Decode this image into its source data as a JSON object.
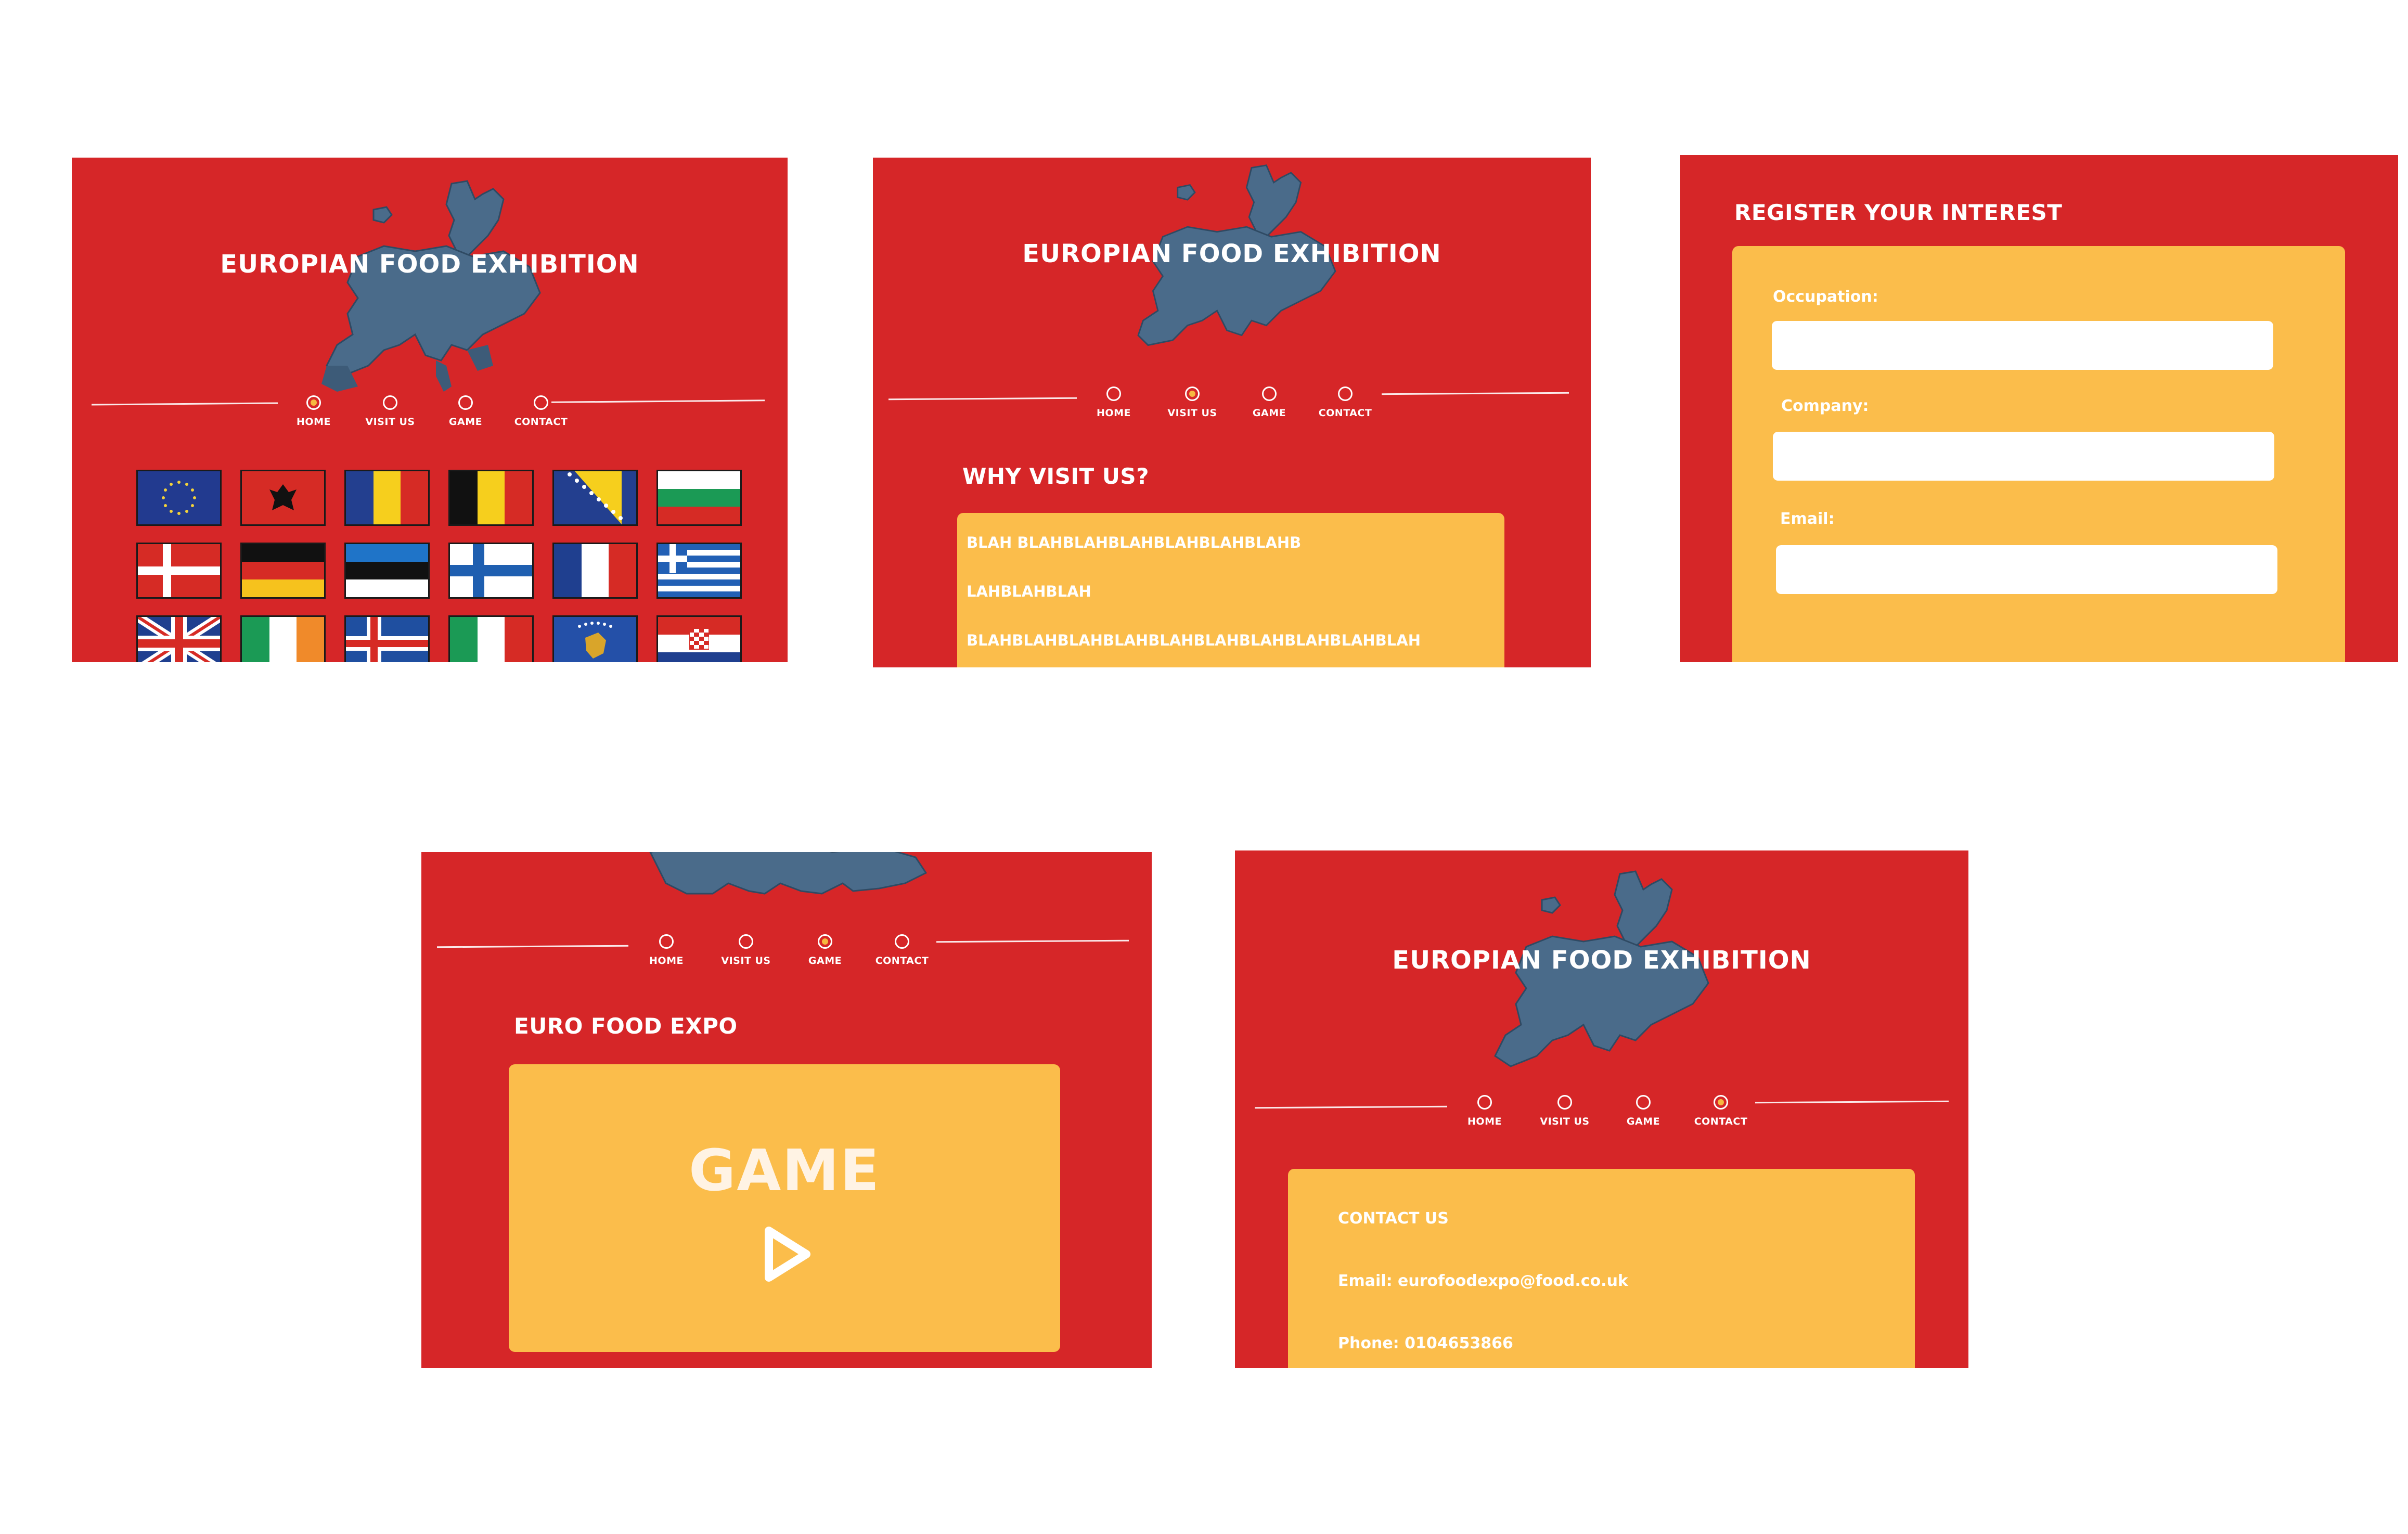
{
  "site_title": "EUROPIAN FOOD EXHIBITION",
  "nav": [
    {
      "label": "HOME"
    },
    {
      "label": "VISIT US"
    },
    {
      "label": "GAME"
    },
    {
      "label": "CONTACT"
    }
  ],
  "panel_home": {
    "active_nav": "HOME",
    "flags": [
      "eu-flag",
      "albania-flag",
      "romania-flag",
      "belgium-flag",
      "bosnia-flag",
      "bulgaria-flag",
      "denmark-flag",
      "germany-flag",
      "estonia-flag",
      "finland-flag",
      "france-flag",
      "greece-flag",
      "uk-flag",
      "ireland-flag",
      "iceland-flag",
      "italy-flag",
      "kosovo-flag",
      "croatia-flag"
    ]
  },
  "panel_visit": {
    "active_nav": "VISIT US",
    "heading": "WHY VISIT US?",
    "lines": [
      "BLAH BLAHBLAHBLAHBLAHBLAHBLAHB",
      "LAHBLAHBLAH",
      "BLAHBLAHBLAHBLAHBLAHBLAHBLAHBLAHBLAHBLAH"
    ]
  },
  "panel_register": {
    "heading": "REGISTER YOUR INTEREST",
    "fields": [
      {
        "label": "Occupation:",
        "value": ""
      },
      {
        "label": "Company:",
        "value": ""
      },
      {
        "label": "Email:",
        "value": ""
      }
    ]
  },
  "panel_game": {
    "active_nav": "GAME",
    "heading": "EURO FOOD EXPO",
    "game_label": "GAME",
    "play_icon": "play-icon"
  },
  "panel_contact": {
    "active_nav": "CONTACT",
    "heading": "CONTACT US",
    "email": "Email: eurofoodexpo@food.co.uk",
    "phone": "Phone: 0104653866"
  },
  "colors": {
    "background": "#d62628",
    "card": "#fbbd4b",
    "map": "#4a6b8a",
    "text": "#ffffff"
  }
}
